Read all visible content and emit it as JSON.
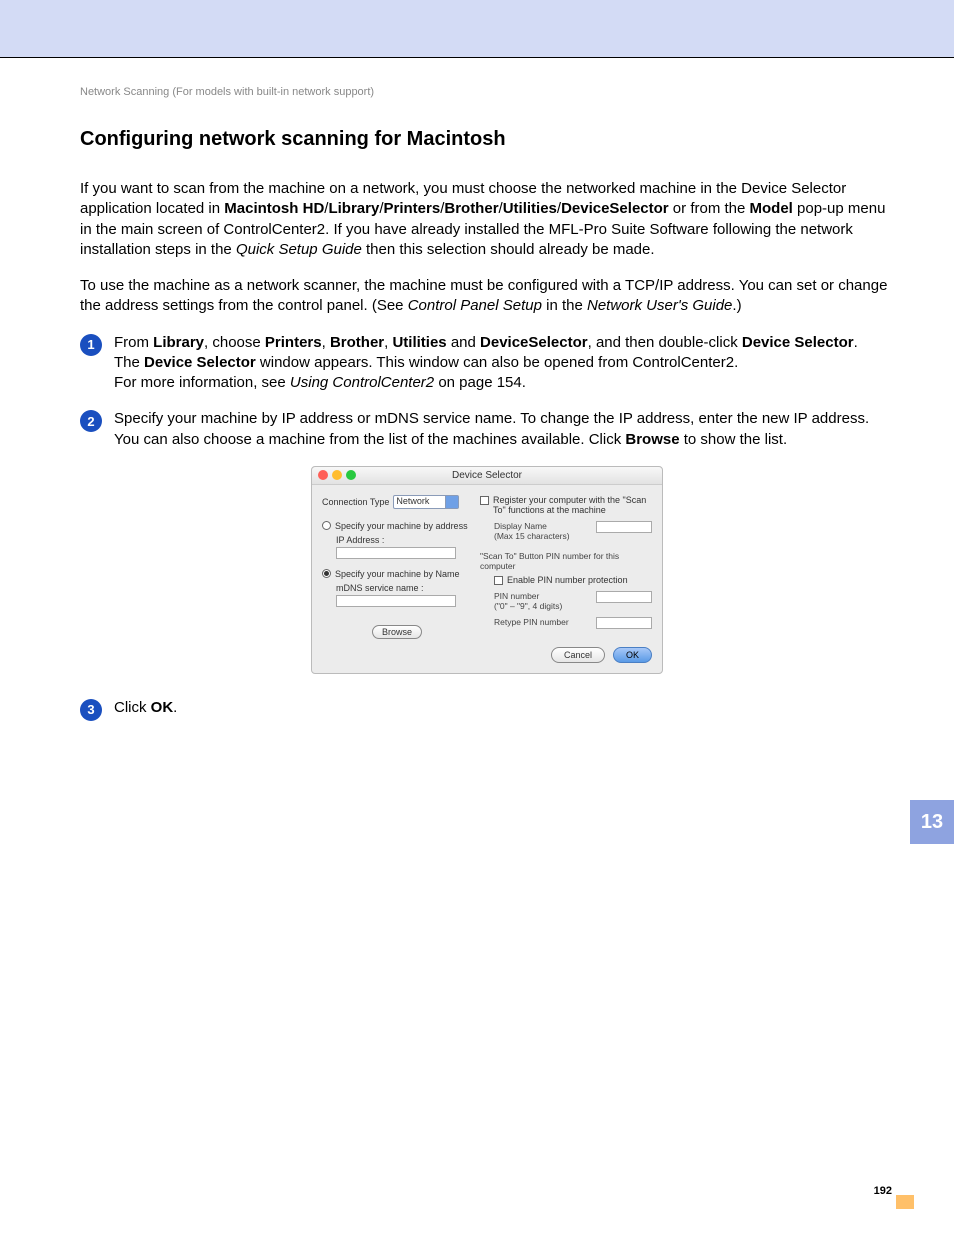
{
  "chapter_tab": "13",
  "page_number": "192",
  "breadcrumb": "Network Scanning (For models with built-in network support)",
  "heading": "Configuring network scanning for Macintosh",
  "intro_html": "If you want to scan from the machine on a network, you must choose the networked machine in the Device Selector application located in <b>Macintosh HD</b>/<b>Library</b>/<b>Printers</b>/<b>Brother</b>/<b>Utilities</b>/<b>DeviceSelector</b> or from the <b>Model</b> pop-up menu in the main screen of ControlCenter2. If you have already installed the MFL-Pro Suite Software following the network installation steps in the <i>Quick Setup Guide</i> then this selection should already be made.",
  "para2_html": "To use the machine as a network scanner, the machine must be configured with a TCP/IP address. You can set or change the address settings from the control panel. (See <i>Control Panel Setup</i> in the <i>Network User's Guide</i>.)",
  "steps": {
    "s1_l1_html": "From <b>Library</b>, choose <b>Printers</b>, <b>Brother</b>, <b>Utilities</b> and <b>DeviceSelector</b>, and then double-click <b>Device Selector</b>.",
    "s1_l2_html": "The <b>Device Selector</b> window appears. This window can also be opened from ControlCenter2.",
    "s1_l3_html": "For more information, see <i>Using ControlCenter2</i> on page 154.",
    "s2_l1": "Specify your machine by IP address or mDNS service name. To change the IP address, enter the new IP address.",
    "s2_l2_html": "You can also choose a machine from the list of the machines available. Click <b>Browse</b> to show the list.",
    "s3_html": "Click <b>OK</b>."
  },
  "dialog": {
    "title": "Device Selector",
    "conn_type_label": "Connection Type",
    "conn_type_value": "Network",
    "by_address": "Specify your machine by address",
    "ip_address_label": "IP Address :",
    "by_name": "Specify your machine by Name",
    "mdns_label": "mDNS service name :",
    "browse": "Browse",
    "register_chk": "Register your computer with the \"Scan To\" functions at the machine",
    "display_name": "Display Name",
    "display_name_hint": "(Max 15 characters)",
    "pin_section": "\"Scan To\" Button PIN number for this computer",
    "enable_pin": "Enable PIN number protection",
    "pin_number": "PIN number",
    "pin_hint": "(\"0\" – \"9\",  4 digits)",
    "retype_pin": "Retype PIN number",
    "cancel": "Cancel",
    "ok": "OK"
  }
}
